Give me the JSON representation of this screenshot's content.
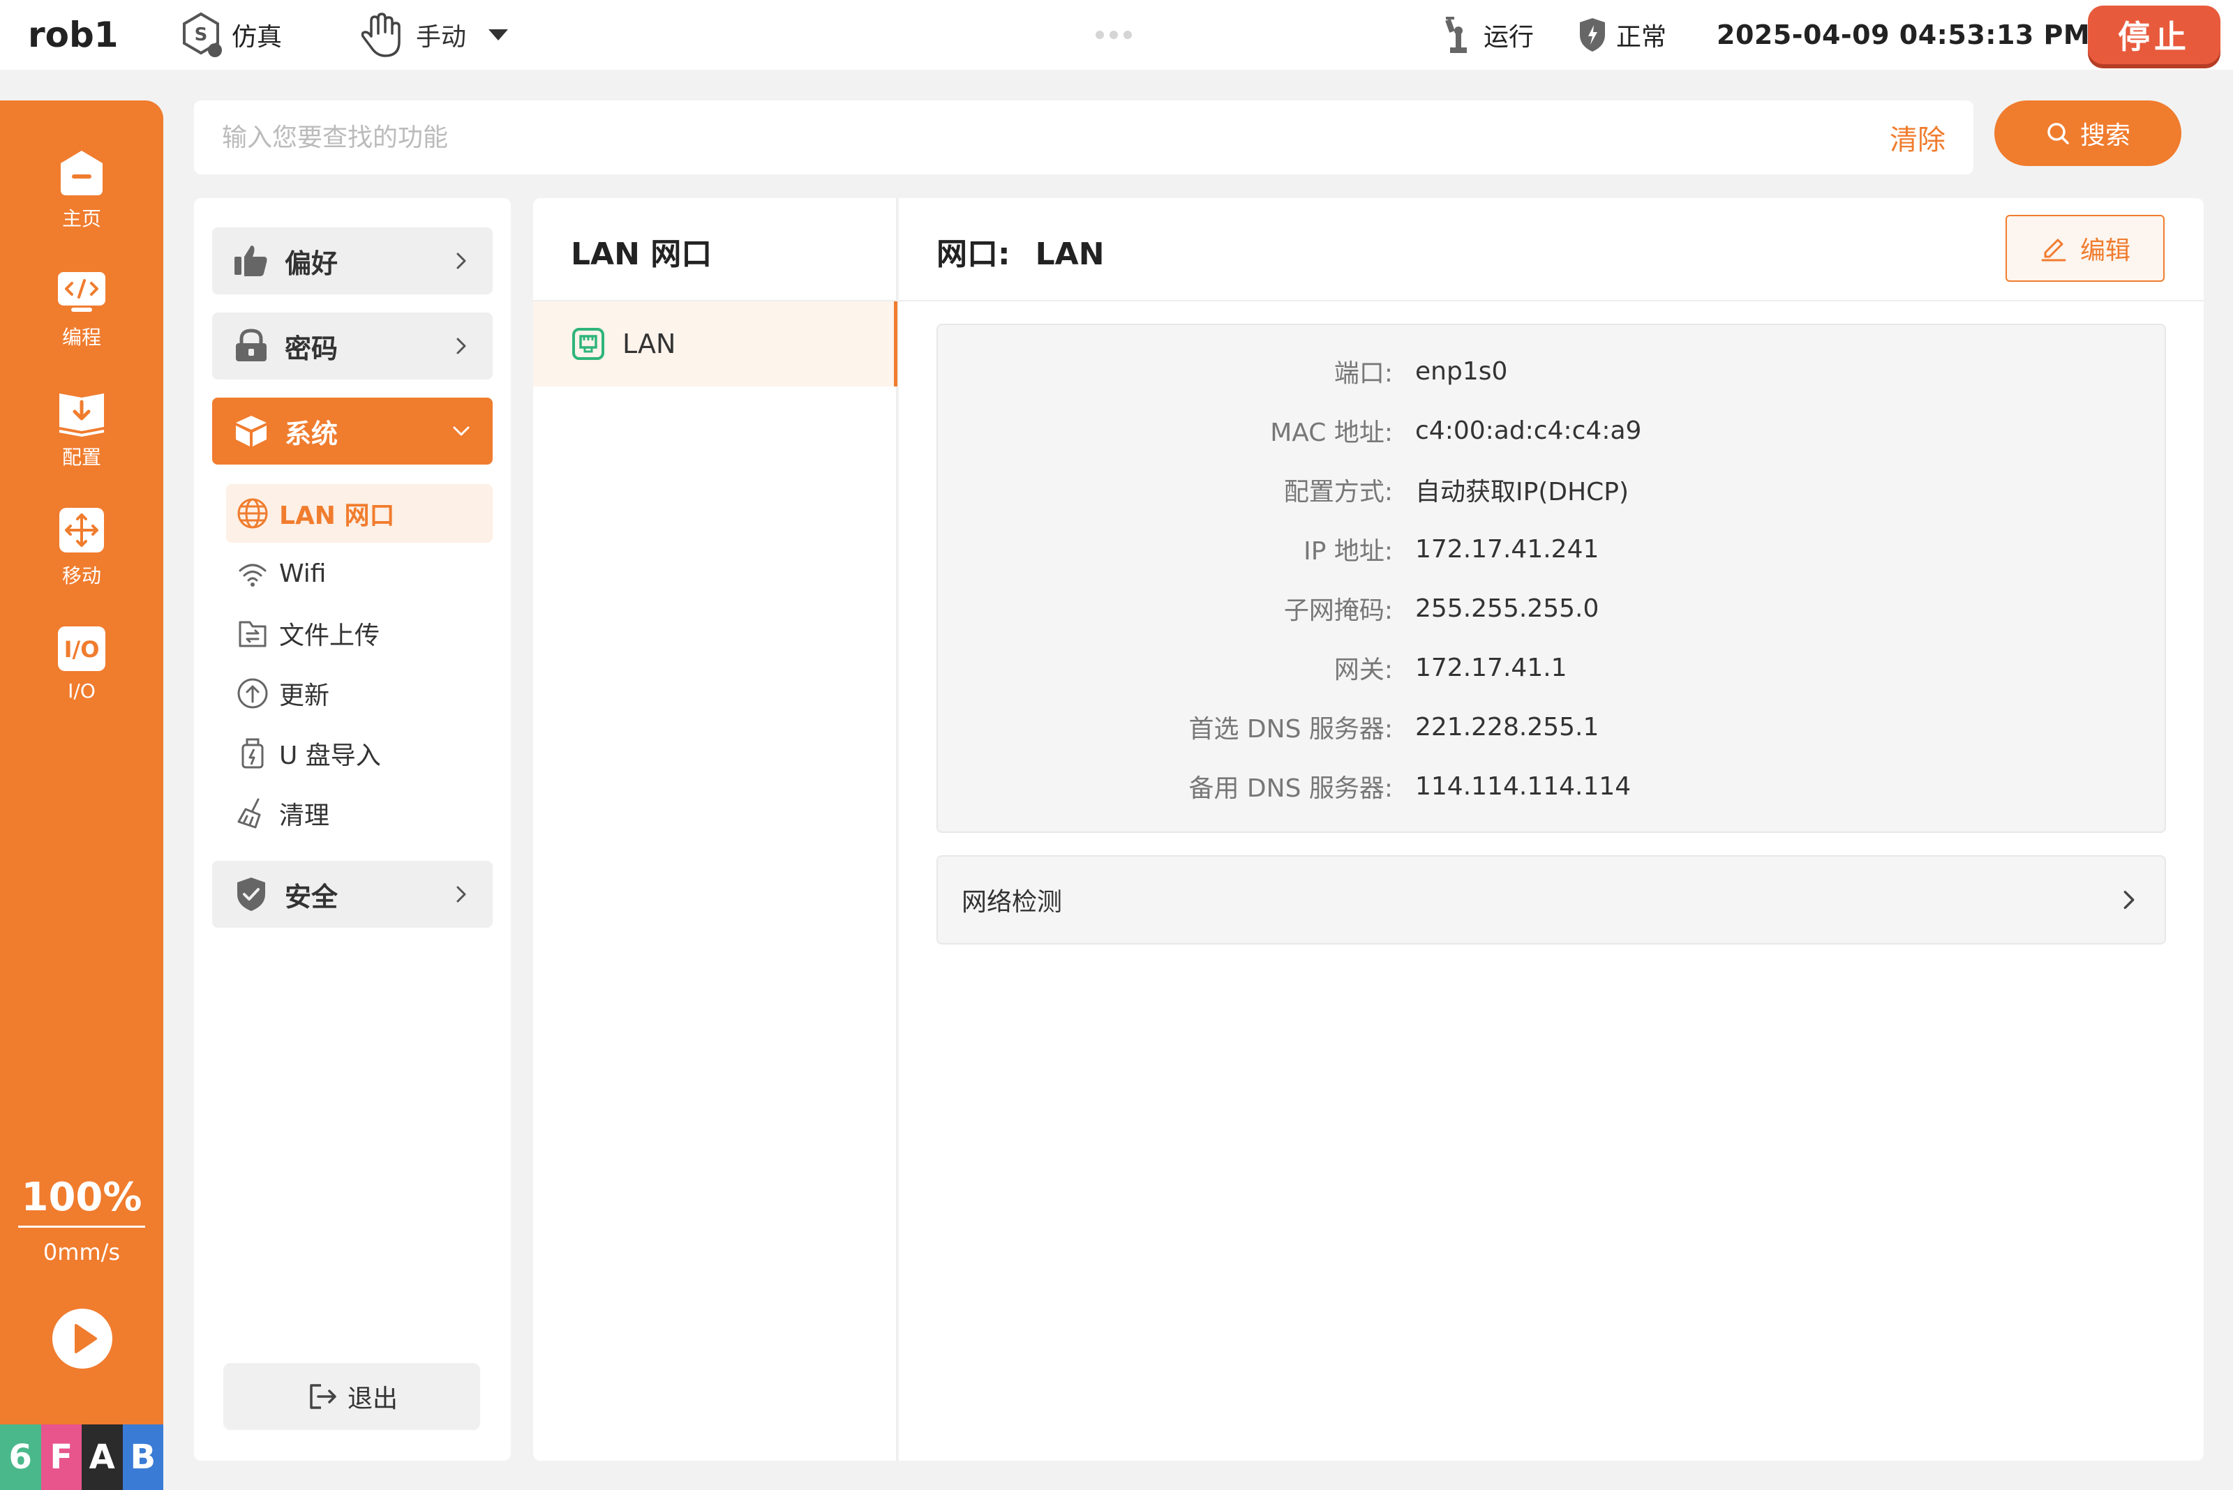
{
  "topbar": {
    "robot_name": "rob1",
    "sim_mode": "仿真",
    "op_mode": "手动",
    "run_status": "运行",
    "safety_status": "正常",
    "datetime": "2025-04-09 04:53:13 PM",
    "stop_label": "停止"
  },
  "rail": {
    "items": [
      {
        "label": "主页",
        "icon": "home-icon"
      },
      {
        "label": "编程",
        "icon": "code-icon"
      },
      {
        "label": "配置",
        "icon": "config-icon"
      },
      {
        "label": "移动",
        "icon": "move-icon"
      },
      {
        "label": "I/O",
        "icon": "io-icon"
      }
    ],
    "speed_percent": "100%",
    "speed_value": "0mm/s",
    "brand": [
      "6",
      "F",
      "A",
      "B"
    ],
    "brand_colors": [
      "#4ab88a",
      "#e8548c",
      "#2b2b2b",
      "#3a7bd5"
    ]
  },
  "search": {
    "placeholder": "输入您要查找的功能",
    "clear_label": "清除",
    "search_label": "搜索"
  },
  "menu": {
    "groups": {
      "preference": "偏好",
      "password": "密码",
      "system": "系统",
      "security": "安全"
    },
    "system_items": [
      {
        "label": "LAN 网口",
        "icon": "globe-icon"
      },
      {
        "label": "Wifi",
        "icon": "wifi-icon"
      },
      {
        "label": "文件上传",
        "icon": "file-upload-icon"
      },
      {
        "label": "更新",
        "icon": "update-icon"
      },
      {
        "label": "U 盘导入",
        "icon": "usb-icon"
      },
      {
        "label": "清理",
        "icon": "broom-icon"
      }
    ],
    "logout_label": "退出"
  },
  "ports": {
    "title": "LAN 网口",
    "items": [
      "LAN"
    ]
  },
  "detail": {
    "title_prefix": "网口:",
    "title_value": "LAN",
    "edit_label": "编辑",
    "fields": [
      {
        "key": "端口:",
        "value": "enp1s0"
      },
      {
        "key": "MAC 地址:",
        "value": "c4:00:ad:c4:c4:a9"
      },
      {
        "key": "配置方式:",
        "value": "自动获取IP(DHCP)"
      },
      {
        "key": "IP 地址:",
        "value": "172.17.41.241"
      },
      {
        "key": "子网掩码:",
        "value": "255.255.255.0"
      },
      {
        "key": "网关:",
        "value": "172.17.41.1"
      },
      {
        "key": "首选 DNS 服务器:",
        "value": "221.228.255.1"
      },
      {
        "key": "备用 DNS 服务器:",
        "value": "114.114.114.114"
      }
    ],
    "network_check_label": "网络检测"
  },
  "colors": {
    "accent": "#f07c2e",
    "stop": "#e85a3c"
  }
}
